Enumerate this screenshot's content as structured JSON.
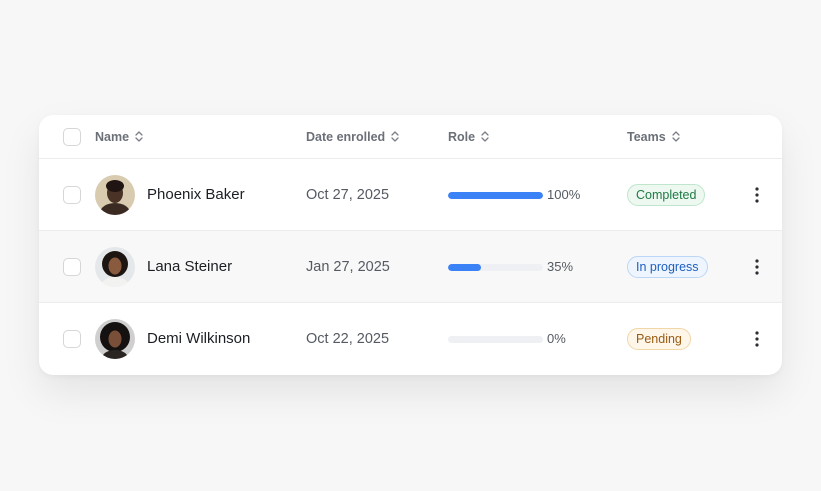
{
  "header": {
    "name_label": "Name",
    "date_label": "Date enrolled",
    "role_label": "Role",
    "teams_label": "Teams"
  },
  "rows": [
    {
      "name": "Phoenix Baker",
      "date": "Oct 27, 2025",
      "progress": 1.0,
      "progress_label": "100%",
      "status": "Completed",
      "status_color": "#1f7a45",
      "status_bg": "#ecf8f0",
      "status_border": "#bfe6cc"
    },
    {
      "name": "Lana Steiner",
      "date": "Jan 27, 2025",
      "progress": 0.35,
      "progress_label": "35%",
      "status": "In progress",
      "status_color": "#1d5fbf",
      "status_bg": "#eef5fe",
      "status_border": "#bcd6f6"
    },
    {
      "name": "Demi Wilkinson",
      "date": "Oct 22, 2025",
      "progress": 0.0,
      "progress_label": "0%",
      "status": "Pending",
      "status_color": "#9a5a12",
      "status_bg": "#fdf6e9",
      "status_border": "#f1d7a8"
    }
  ],
  "colors": {
    "accent": "#3b82f6"
  }
}
